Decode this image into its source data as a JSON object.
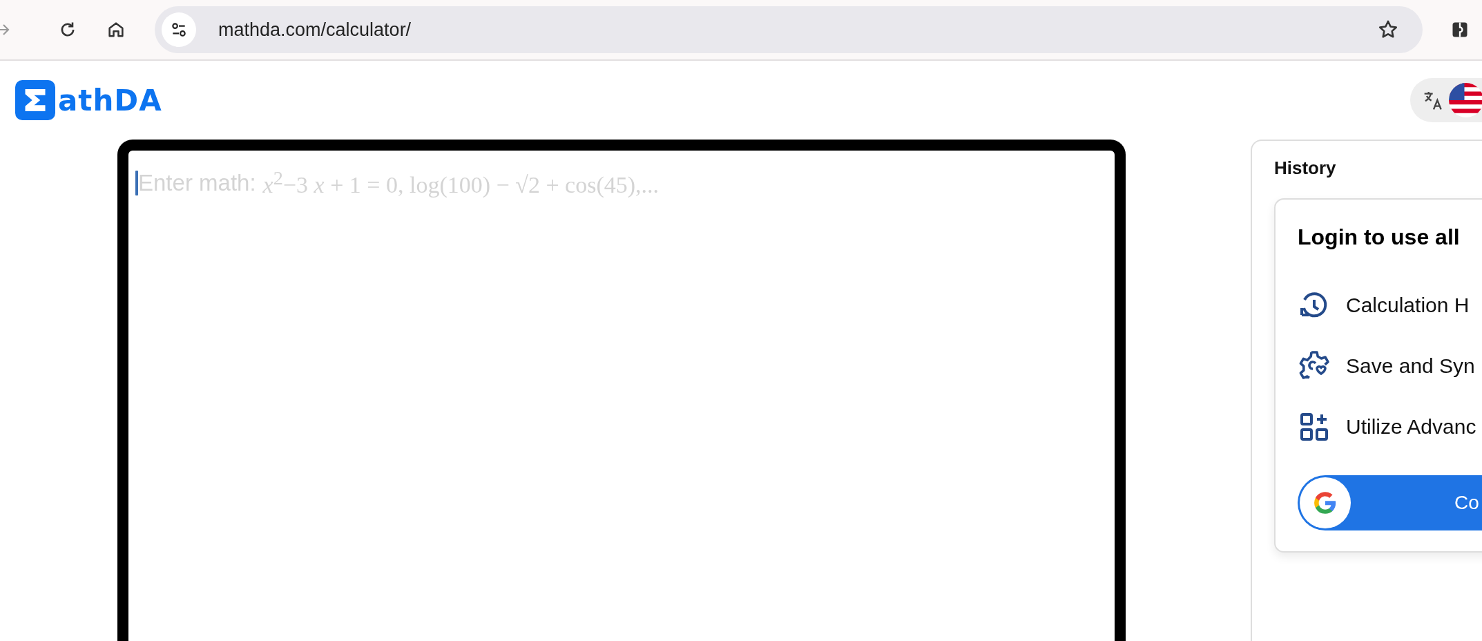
{
  "browser": {
    "url": "mathda.com/calculator/"
  },
  "logo": {
    "text": "athDA"
  },
  "editor": {
    "placeholder_label": "Enter math:",
    "placeholder_math": "*x*$^{2}$−3 *x* + 1 = 0,  log(100) − √2 + cos(45),..."
  },
  "history": {
    "title": "History",
    "login_card": {
      "title": "Login to use all",
      "features": [
        {
          "kind": "history",
          "text": "Calculation H"
        },
        {
          "kind": "sync",
          "text": "Save and Syn"
        },
        {
          "kind": "tools",
          "text": "Utilize Advanc"
        }
      ],
      "button": {
        "label": "Co"
      }
    }
  }
}
